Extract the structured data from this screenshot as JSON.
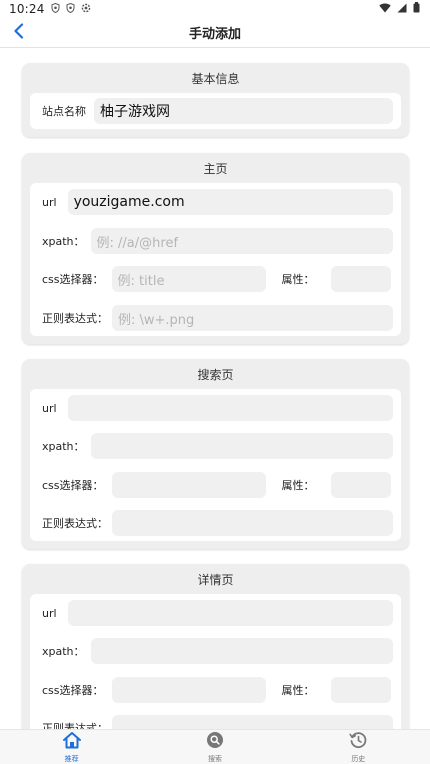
{
  "status_bar": {
    "time": "10:24",
    "icons": [
      "shield-icon",
      "shield-icon",
      "settings-icon"
    ],
    "right_icons": [
      "wifi-icon",
      "signal-icon",
      "battery-icon"
    ]
  },
  "header": {
    "title": "手动添加",
    "back_icon": "chevron-left-icon"
  },
  "sections": {
    "basic": {
      "title": "基本信息",
      "site_name_label": "站点名称",
      "site_name_value": "柚子游戏网"
    },
    "home": {
      "title": "主页",
      "url_label": "url",
      "url_value": "youzigame.com",
      "xpath_label": "xpath：",
      "xpath_placeholder": "例: //a/@href",
      "css_label": "css选择器：",
      "css_placeholder": "例: title",
      "attr_label": "属性：",
      "regex_label": "正则表达式：",
      "regex_placeholder": "例: \\w+.png"
    },
    "search": {
      "title": "搜索页",
      "url_label": "url",
      "xpath_label": "xpath：",
      "css_label": "css选择器：",
      "attr_label": "属性：",
      "regex_label": "正则表达式："
    },
    "detail": {
      "title": "详情页",
      "url_label": "url",
      "xpath_label": "xpath：",
      "css_label": "css选择器：",
      "attr_label": "属性：",
      "regex_label": "正则表达式："
    }
  },
  "bottom_nav": {
    "items": [
      {
        "label": "推荐",
        "icon": "home-icon",
        "active": true
      },
      {
        "label": "搜索",
        "icon": "search-icon",
        "active": false
      },
      {
        "label": "历史",
        "icon": "history-icon",
        "active": false
      }
    ]
  },
  "colors": {
    "accent": "#1e6fd9",
    "section_bg": "#eeeeee",
    "field_bg": "#f0f0f0",
    "placeholder": "#b5b5b5"
  }
}
